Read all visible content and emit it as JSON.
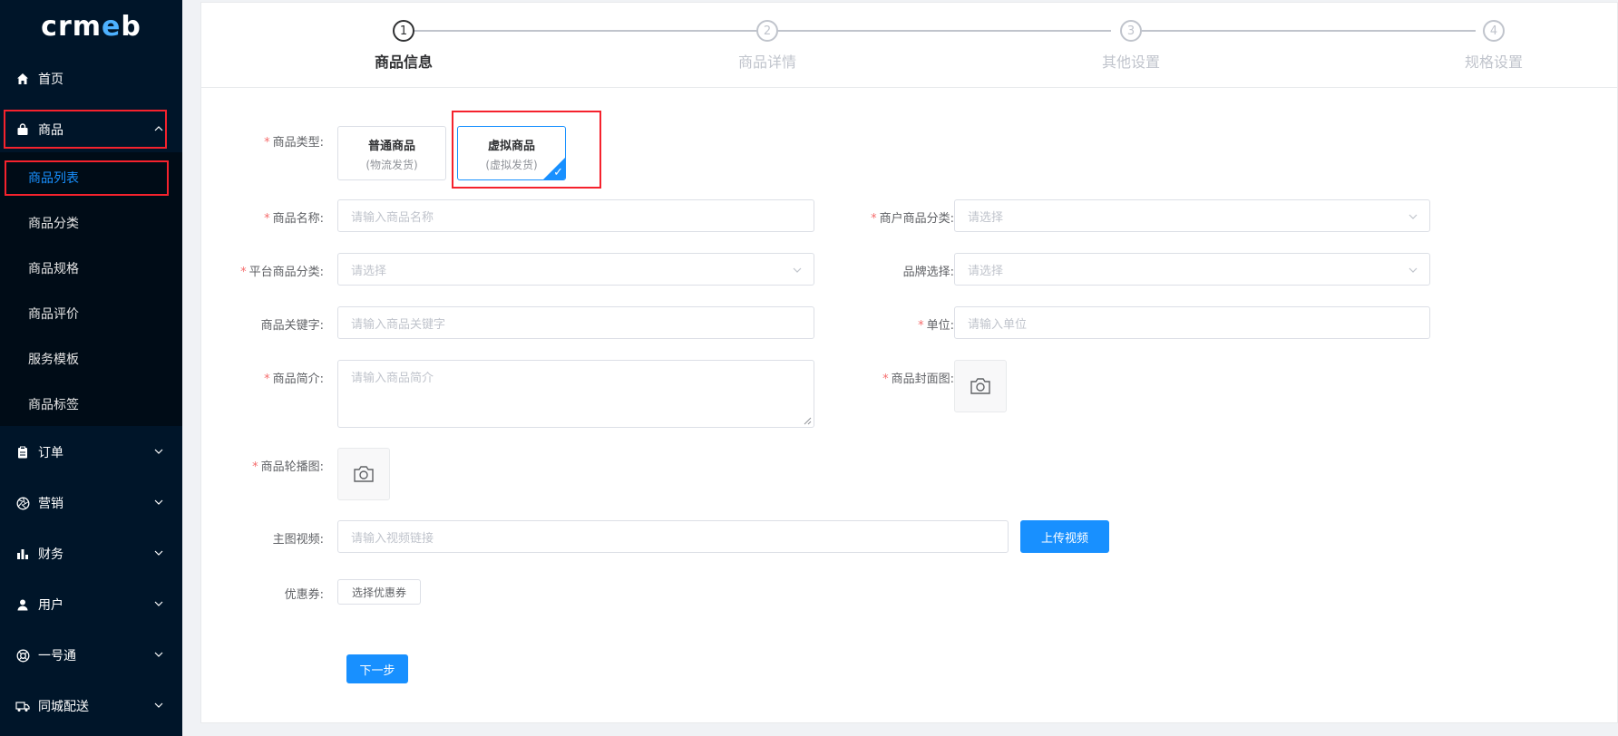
{
  "logo": {
    "part1": "crm",
    "part2": "e",
    "part3": "b"
  },
  "sidebar": {
    "home": "首页",
    "goods": "商品",
    "goods_sub": [
      "商品列表",
      "商品分类",
      "商品规格",
      "商品评价",
      "服务模板",
      "商品标签"
    ],
    "orders": "订单",
    "marketing": "营销",
    "finance": "财务",
    "users": "用户",
    "yihaotong": "一号通",
    "delivery": "同城配送"
  },
  "steps": [
    {
      "num": "1",
      "label": "商品信息"
    },
    {
      "num": "2",
      "label": "商品详情"
    },
    {
      "num": "3",
      "label": "其他设置"
    },
    {
      "num": "4",
      "label": "规格设置"
    }
  ],
  "form": {
    "type_label": "商品类型:",
    "type_normal": {
      "title": "普通商品",
      "sub": "(物流发货)"
    },
    "type_virtual": {
      "title": "虚拟商品",
      "sub": "(虚拟发货)"
    },
    "name_label": "商品名称:",
    "name_placeholder": "请输入商品名称",
    "merchant_cat_label": "商户商品分类:",
    "merchant_cat_placeholder": "请选择",
    "platform_cat_label": "平台商品分类:",
    "platform_cat_placeholder": "请选择",
    "brand_label": "品牌选择:",
    "brand_placeholder": "请选择",
    "keyword_label": "商品关键字:",
    "keyword_placeholder": "请输入商品关键字",
    "unit_label": "单位:",
    "unit_placeholder": "请输入单位",
    "intro_label": "商品简介:",
    "intro_placeholder": "请输入商品简介",
    "cover_label": "商品封面图:",
    "carousel_label": "商品轮播图:",
    "video_label": "主图视频:",
    "video_placeholder": "请输入视频链接",
    "upload_video": "上传视频",
    "coupon_label": "优惠券:",
    "coupon_button": "选择优惠券",
    "next_button": "下一步"
  },
  "colors": {
    "accent": "#1890ff",
    "sidebar": "#001529",
    "highlight": "#f5222d"
  }
}
